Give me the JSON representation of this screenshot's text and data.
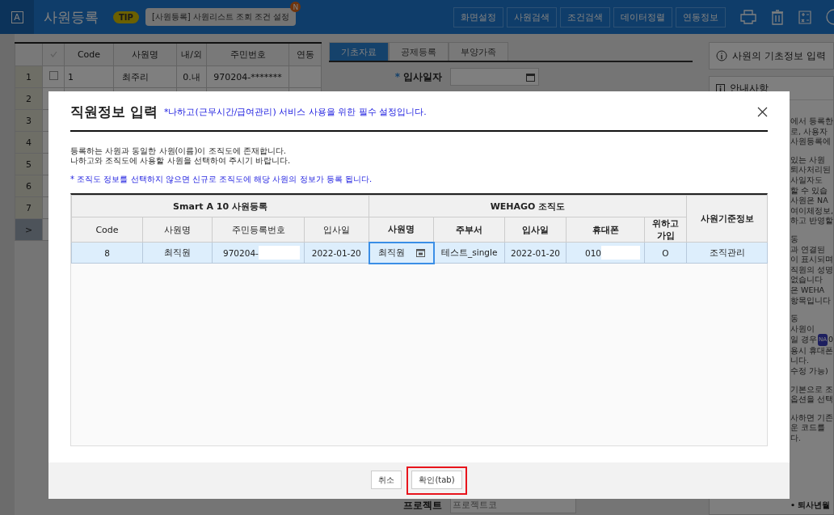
{
  "app": {
    "logo": "A",
    "title": "사원등록",
    "tip": {
      "badge": "TIP",
      "text": "[사원등록] 사원리스트 조회 조건 설정",
      "new_badge": "N"
    },
    "toolbar": [
      "화면설정",
      "사원검색",
      "조건검색",
      "데이터정렬",
      "연동정보"
    ]
  },
  "employee_grid": {
    "columns": [
      "Code",
      "사원명",
      "내/외",
      "주민번호",
      "연동"
    ],
    "rows": [
      {
        "no": "1",
        "selected": false,
        "checked": false,
        "code": "1",
        "name": "최주리",
        "type": "0.내",
        "rrn": "970204-*******"
      },
      {
        "no": "2",
        "selected": false
      },
      {
        "no": "3",
        "selected": false
      },
      {
        "no": "4",
        "selected": false
      },
      {
        "no": "5",
        "selected": false
      },
      {
        "no": "6",
        "selected": false
      },
      {
        "no": "7",
        "selected": false
      },
      {
        "no": ">",
        "selected": true
      }
    ]
  },
  "detail_tabs": [
    {
      "label": "기초자료",
      "selected": true
    },
    {
      "label": "공제등록",
      "selected": false
    },
    {
      "label": "부양가족",
      "selected": false
    }
  ],
  "detail_form": {
    "hire_date": {
      "label": "입사일자",
      "required_mark": "*"
    },
    "project": {
      "label": "프로젝트",
      "placeholder": "프로젝트코"
    }
  },
  "guide_panel": {
    "heading": "사원의 기초정보 입력",
    "notice_title": "안내사항",
    "paragraphs": [
      [
        {
          "text": "에서 등록한"
        },
        {
          "text": "로, 사용자"
        },
        {
          "text": "사원등록에"
        }
      ],
      [
        {
          "text": "있는 사원"
        },
        {
          "text": "퇴사처리된"
        },
        {
          "text": "사일자도"
        },
        {
          "text": "할 수 있습"
        },
        {
          "text": "사원은 NA"
        },
        {
          "text": "여이체정보,"
        },
        {
          "text": "하고 반영할"
        }
      ],
      [
        {
          "text": "동"
        },
        {
          "text": "과 연결된"
        },
        {
          "text": "이 표시되며"
        },
        {
          "text": "직원의 성명"
        },
        {
          "text": "없습니다"
        },
        {
          "text": "은 WEHA"
        },
        {
          "text": "항목입니다"
        }
      ],
      [
        {
          "text": "동"
        },
        {
          "text": "사원이"
        },
        {
          "text": "일 경우",
          "badge": "NA",
          "tail": "0"
        },
        {
          "text": "용시 휴대폰"
        },
        {
          "text": "니다."
        },
        {
          "text": "수정 가능)"
        }
      ],
      [
        {
          "text": "기본으로 조"
        },
        {
          "text": "옵션을 선택"
        }
      ],
      [
        {
          "text": "사하면 기존"
        },
        {
          "text": "운 코드를"
        },
        {
          "text": "다."
        }
      ]
    ],
    "footer_item": "• 퇴사년월"
  },
  "dialog": {
    "title": "직원정보 입력",
    "subtitle": "*나하고(근무시간/급여관리) 서비스 사용을 위한 필수 설정입니다.",
    "message": [
      "등록하는 사원과 동일한 사원(이름)이 조직도에 존재합니다.",
      "나하고와 조직도에 사용할 사원을 선택하여 주시기 바랍니다."
    ],
    "note": "* 조직도 정보를 선택하지 않으면 신규로 조직도에 해당 사원의 정보가 등록 됩니다.",
    "table": {
      "groups": [
        "Smart A 10 사원등록",
        "WEHAGO 조직도",
        "사원기준정보"
      ],
      "columns": [
        "Code",
        "사원명",
        "주민등록번호",
        "입사일",
        "사원명",
        "주부서",
        "입사일",
        "휴대폰",
        "위하고 가입"
      ],
      "rows": [
        {
          "selected": true,
          "cells": [
            {
              "text": "8",
              "masked": false,
              "focused": false
            },
            {
              "text": "최직원",
              "masked": false,
              "focused": false
            },
            {
              "text": "970204-",
              "masked": true,
              "focused": false
            },
            {
              "text": "2022-01-20",
              "masked": false,
              "focused": false
            },
            {
              "text": "최직원",
              "masked": false,
              "focused": true
            },
            {
              "text": "테스트_single",
              "masked": false,
              "focused": false
            },
            {
              "text": "2022-01-20",
              "masked": false,
              "focused": false
            },
            {
              "text": "010",
              "masked": true,
              "focused": false
            },
            {
              "text": "O",
              "masked": false,
              "focused": false
            },
            {
              "text": "조직관리",
              "masked": false,
              "focused": false
            }
          ]
        }
      ]
    },
    "buttons": [
      {
        "label": "취소",
        "highlighted": false
      },
      {
        "label": "확인(tab)",
        "highlighted": true
      }
    ]
  }
}
